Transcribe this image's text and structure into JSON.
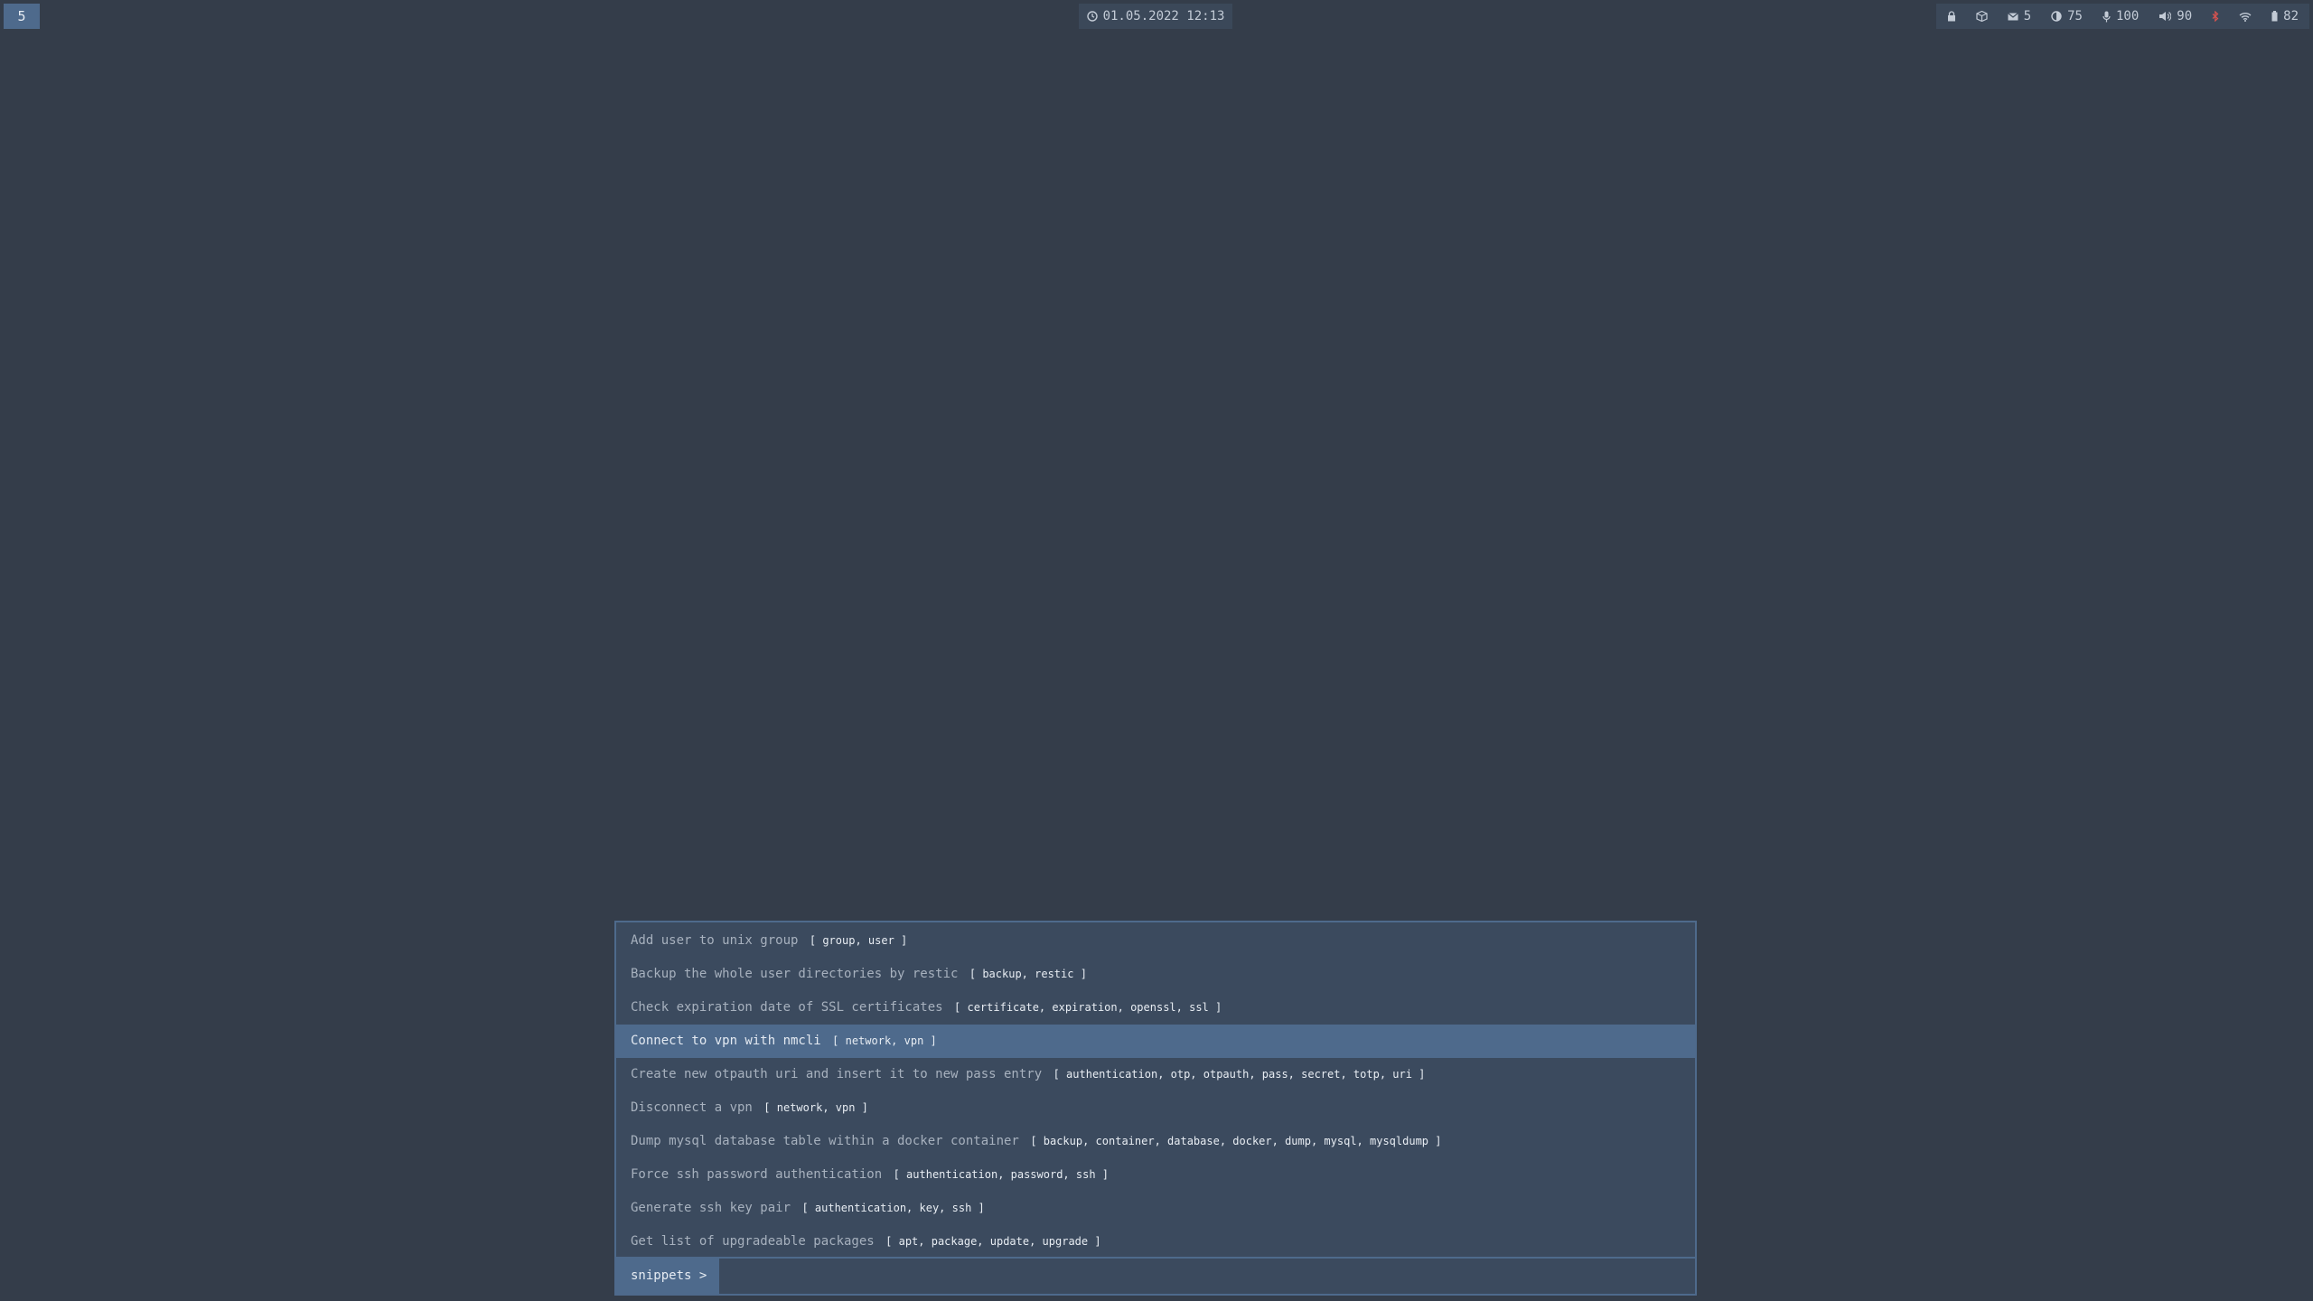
{
  "workspace": {
    "label": "5"
  },
  "clock": {
    "text": "01.05.2022 12:13",
    "icon": "clock-icon"
  },
  "tray": {
    "lock_icon": "lock-icon",
    "package_icon": "package-icon",
    "mail": {
      "icon": "mail-icon",
      "value": "5"
    },
    "brightness": {
      "icon": "brightness-icon",
      "value": "75"
    },
    "microphone": {
      "icon": "microphone-icon",
      "value": "100"
    },
    "volume": {
      "icon": "volume-icon",
      "value": "90"
    },
    "bluetooth_icon": "bluetooth-icon",
    "bluetooth_color": "#d9534f",
    "wifi_icon": "wifi-icon",
    "battery": {
      "icon": "battery-icon",
      "value": "82"
    }
  },
  "launcher": {
    "prompt": "snippets >",
    "input_value": "",
    "selected_index": 3,
    "items": [
      {
        "title": "Add user to unix group",
        "tags": "[ group, user ]"
      },
      {
        "title": "Backup the whole user directories by restic",
        "tags": "[ backup, restic ]"
      },
      {
        "title": "Check expiration date of SSL certificates",
        "tags": "[ certificate, expiration, openssl, ssl ]"
      },
      {
        "title": "Connect to vpn with nmcli",
        "tags": "[ network, vpn ]"
      },
      {
        "title": "Create new otpauth uri and insert it to new pass entry",
        "tags": "[ authentication, otp, otpauth, pass, secret, totp, uri ]"
      },
      {
        "title": "Disconnect a vpn",
        "tags": "[ network, vpn ]"
      },
      {
        "title": "Dump mysql database table within a docker container",
        "tags": "[ backup, container, database, docker, dump, mysql, mysqldump ]"
      },
      {
        "title": "Force ssh password authentication",
        "tags": "[ authentication, password, ssh ]"
      },
      {
        "title": "Generate ssh key pair",
        "tags": "[ authentication, key, ssh ]"
      },
      {
        "title": "Get list of upgradeable packages",
        "tags": "[ apt, package, update, upgrade ]"
      }
    ]
  },
  "colors": {
    "background": "#343d4a",
    "accent": "#4e6a8c",
    "panel": "#3b4a5e"
  }
}
